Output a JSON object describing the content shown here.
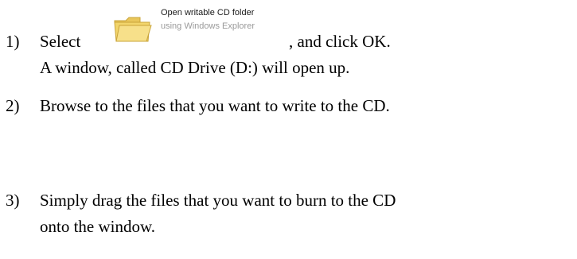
{
  "steps": [
    {
      "number": "1)",
      "text_before": "Select",
      "text_after": ", and click OK.",
      "line2": "A window, called CD Drive (D:) will open up."
    },
    {
      "number": "2)",
      "text": "Browse to the files that you want to write to the CD."
    },
    {
      "number": "3)",
      "text": "Simply drag the files that you want to burn to the CD",
      "line2": "onto the window."
    }
  ],
  "option": {
    "title": "Open writable CD folder",
    "subtitle": "using Windows Explorer",
    "icon": "folder-icon",
    "colors": {
      "folder_fill": "#f2d56b",
      "folder_edge": "#c9a43a"
    }
  }
}
